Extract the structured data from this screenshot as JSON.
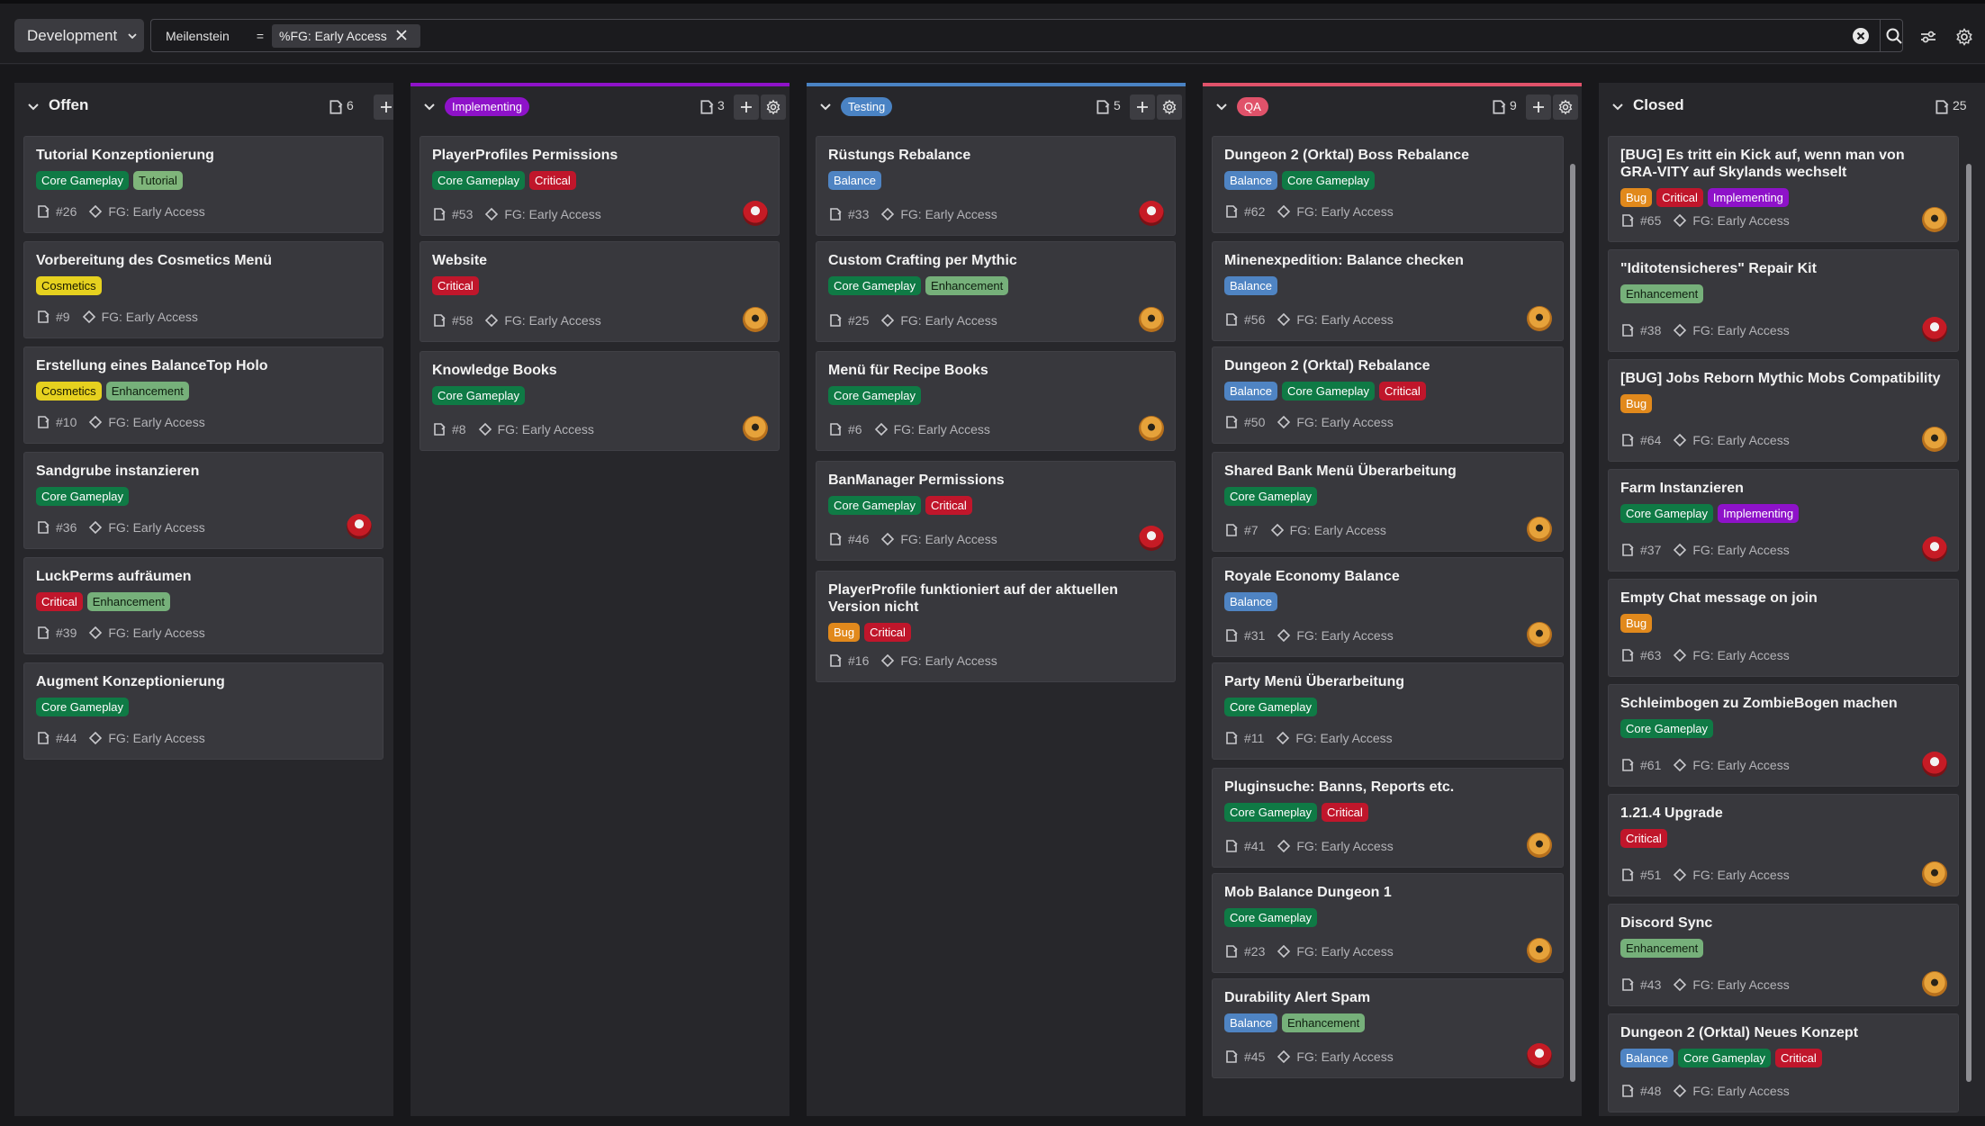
{
  "topbar": {
    "project": "Development",
    "filter": {
      "field": "Meilenstein",
      "operator": "=",
      "value": "%FG: Early Access"
    },
    "icons": [
      "chevron-down-icon",
      "close-icon",
      "clear-circle-icon",
      "search-icon",
      "sliders-icon",
      "gear-icon"
    ]
  },
  "colors": {
    "background": "#18181b",
    "column": "#27272b",
    "card": "#38383d",
    "implementing": "#8e12c9",
    "testing": "#4a83c4",
    "qa": "#e0526a",
    "tag_core_gameplay": "#0f7a45",
    "tag_critical": "#c0162b",
    "tag_tutorial": "#7fb57a",
    "tag_cosmetics": "#e6d11f",
    "tag_enhancement": "#76b07a",
    "tag_balance": "#4f84c3",
    "tag_bug": "#e1891c"
  },
  "columns": [
    {
      "title": "Offen",
      "count": "6",
      "cards": [
        {
          "title": "Tutorial Konzeptionierung",
          "tags": [
            "Core Gameplay",
            "Tutorial"
          ],
          "number": "#26",
          "milestone": "FG: Early Access",
          "avatar": ""
        },
        {
          "title": "Vorbereitung des Cosmetics Menü",
          "tags": [
            "Cosmetics"
          ],
          "number": "#9",
          "milestone": "FG: Early Access",
          "avatar": ""
        },
        {
          "title": "Erstellung eines BalanceTop Holo",
          "tags": [
            "Cosmetics",
            "Enhancement"
          ],
          "number": "#10",
          "milestone": "FG: Early Access",
          "avatar": ""
        },
        {
          "title": "Sandgrube instanzieren",
          "tags": [
            "Core Gameplay"
          ],
          "number": "#36",
          "milestone": "FG: Early Access",
          "avatar": "red"
        },
        {
          "title": "LuckPerms aufräumen",
          "tags": [
            "Critical",
            "Enhancement"
          ],
          "number": "#39",
          "milestone": "FG: Early Access",
          "avatar": ""
        },
        {
          "title": "Augment Konzeptionierung",
          "tags": [
            "Core Gameplay"
          ],
          "number": "#44",
          "milestone": "FG: Early Access",
          "avatar": ""
        }
      ]
    },
    {
      "title": "Implementing",
      "count": "3",
      "cards": [
        {
          "title": "PlayerProfiles Permissions",
          "tags": [
            "Core Gameplay",
            "Critical"
          ],
          "number": "#53",
          "milestone": "FG: Early Access",
          "avatar": "red"
        },
        {
          "title": "Website",
          "tags": [
            "Critical"
          ],
          "number": "#58",
          "milestone": "FG: Early Access",
          "avatar": "orange"
        },
        {
          "title": "Knowledge Books",
          "tags": [
            "Core Gameplay"
          ],
          "number": "#8",
          "milestone": "FG: Early Access",
          "avatar": "orange"
        }
      ]
    },
    {
      "title": "Testing",
      "count": "5",
      "cards": [
        {
          "title": "Rüstungs Rebalance",
          "tags": [
            "Balance"
          ],
          "number": "#33",
          "milestone": "FG: Early Access",
          "avatar": "red"
        },
        {
          "title": "Custom Crafting per Mythic",
          "tags": [
            "Core Gameplay",
            "Enhancement"
          ],
          "number": "#25",
          "milestone": "FG: Early Access",
          "avatar": "orange"
        },
        {
          "title": "Menü für Recipe Books",
          "tags": [
            "Core Gameplay"
          ],
          "number": "#6",
          "milestone": "FG: Early Access",
          "avatar": "orange"
        },
        {
          "title": "BanManager Permissions",
          "tags": [
            "Core Gameplay",
            "Critical"
          ],
          "number": "#46",
          "milestone": "FG: Early Access",
          "avatar": "red"
        },
        {
          "title": "PlayerProfile funktioniert auf der aktuellen Version nicht",
          "tags": [
            "Bug",
            "Critical"
          ],
          "number": "#16",
          "milestone": "FG: Early Access",
          "avatar": ""
        }
      ]
    },
    {
      "title": "QA",
      "count": "9",
      "cards": [
        {
          "title": "Dungeon 2 (Orktal) Boss Rebalance",
          "tags": [
            "Balance",
            "Core Gameplay"
          ],
          "number": "#62",
          "milestone": "FG: Early Access",
          "avatar": ""
        },
        {
          "title": "Minenexpedition: Balance checken",
          "tags": [
            "Balance"
          ],
          "number": "#56",
          "milestone": "FG: Early Access",
          "avatar": "orange"
        },
        {
          "title": "Dungeon 2 (Orktal) Rebalance",
          "tags": [
            "Balance",
            "Core Gameplay",
            "Critical"
          ],
          "number": "#50",
          "milestone": "FG: Early Access",
          "avatar": ""
        },
        {
          "title": "Shared Bank Menü Überarbeitung",
          "tags": [
            "Core Gameplay"
          ],
          "number": "#7",
          "milestone": "FG: Early Access",
          "avatar": "orange"
        },
        {
          "title": "Royale Economy Balance",
          "tags": [
            "Balance"
          ],
          "number": "#31",
          "milestone": "FG: Early Access",
          "avatar": "orange"
        },
        {
          "title": "Party Menü Überarbeitung",
          "tags": [
            "Core Gameplay"
          ],
          "number": "#11",
          "milestone": "FG: Early Access",
          "avatar": ""
        },
        {
          "title": "Pluginsuche: Banns, Reports etc.",
          "tags": [
            "Core Gameplay",
            "Critical"
          ],
          "number": "#41",
          "milestone": "FG: Early Access",
          "avatar": "orange"
        },
        {
          "title": "Mob Balance Dungeon 1",
          "tags": [
            "Core Gameplay"
          ],
          "number": "#23",
          "milestone": "FG: Early Access",
          "avatar": "orange"
        },
        {
          "title": "Durability Alert Spam",
          "tags": [
            "Balance",
            "Enhancement"
          ],
          "number": "#45",
          "milestone": "FG: Early Access",
          "avatar": "red"
        }
      ]
    },
    {
      "title": "Closed",
      "count": "25",
      "cards": [
        {
          "title": "[BUG] Es tritt ein Kick auf, wenn man von GRA-VITY auf Skylands wechselt",
          "tags": [
            "Bug",
            "Critical",
            "Implementing"
          ],
          "number": "#65",
          "milestone": "FG: Early Access",
          "avatar": "orange"
        },
        {
          "title": "\"Iditotensicheres\" Repair Kit",
          "tags": [
            "Enhancement"
          ],
          "number": "#38",
          "milestone": "FG: Early Access",
          "avatar": "red"
        },
        {
          "title": "[BUG] Jobs Reborn Mythic Mobs Compatibility",
          "tags": [
            "Bug"
          ],
          "number": "#64",
          "milestone": "FG: Early Access",
          "avatar": "orange"
        },
        {
          "title": "Farm Instanzieren",
          "tags": [
            "Core Gameplay",
            "Implementing"
          ],
          "number": "#37",
          "milestone": "FG: Early Access",
          "avatar": "red"
        },
        {
          "title": "Empty Chat message on join",
          "tags": [
            "Bug"
          ],
          "number": "#63",
          "milestone": "FG: Early Access",
          "avatar": ""
        },
        {
          "title": "Schleimbogen zu ZombieBogen machen",
          "tags": [
            "Core Gameplay"
          ],
          "number": "#61",
          "milestone": "FG: Early Access",
          "avatar": "red"
        },
        {
          "title": "1.21.4 Upgrade",
          "tags": [
            "Critical"
          ],
          "number": "#51",
          "milestone": "FG: Early Access",
          "avatar": "orange"
        },
        {
          "title": "Discord Sync",
          "tags": [
            "Enhancement"
          ],
          "number": "#43",
          "milestone": "FG: Early Access",
          "avatar": "orange"
        },
        {
          "title": "Dungeon 2 (Orktal) Neues Konzept",
          "tags": [
            "Balance",
            "Core Gameplay",
            "Critical"
          ],
          "number": "#48",
          "milestone": "FG: Early Access",
          "avatar": ""
        }
      ]
    }
  ]
}
